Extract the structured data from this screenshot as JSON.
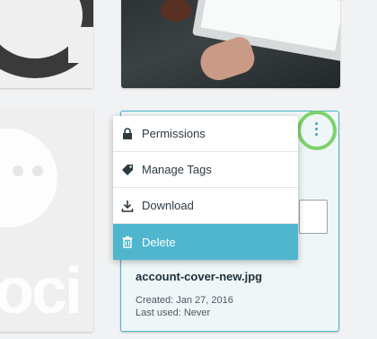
{
  "menu": {
    "items": [
      {
        "label": "Permissions",
        "icon": "lock-icon"
      },
      {
        "label": "Manage Tags",
        "icon": "tag-icon"
      },
      {
        "label": "Download",
        "icon": "download-icon"
      },
      {
        "label": "Delete",
        "icon": "trash-icon",
        "active": true
      }
    ]
  },
  "asset": {
    "file_name": "account-cover-new.jpg",
    "created": "Created: Jan 27, 2016",
    "last_used": "Last used: Never"
  },
  "colors": {
    "accent": "#4fb6cd",
    "highlight_ring": "#7ed26b",
    "selected_border": "#4bb4cc"
  }
}
